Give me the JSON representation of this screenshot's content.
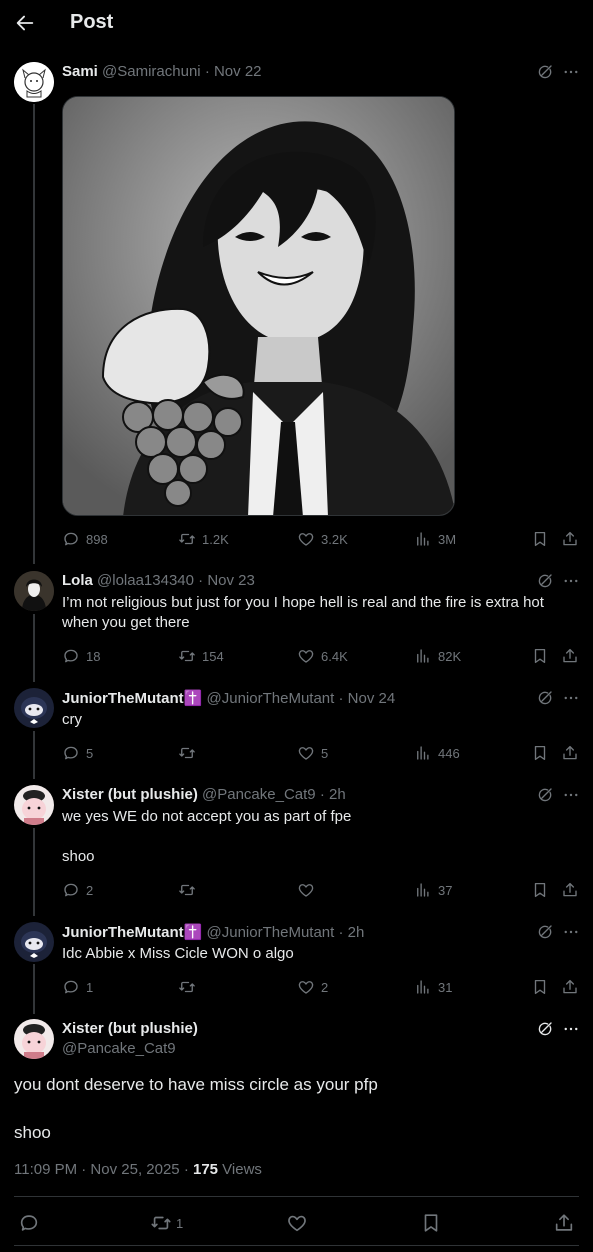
{
  "header": {
    "title": "Post"
  },
  "posts": [
    {
      "name": "Sami",
      "handle": "@Samirachuni",
      "date": "· Nov 22",
      "text": "",
      "replies": "898",
      "reposts": "1.2K",
      "likes": "3.2K",
      "views": "3M"
    },
    {
      "name": "Lola",
      "handle": "@lolaa134340",
      "date": "· Nov 23",
      "text": "I’m not religious but just for you I hope hell is real and the fire is extra hot when you get there",
      "replies": "18",
      "reposts": "154",
      "likes": "6.4K",
      "views": "82K"
    },
    {
      "name": "JuniorTheMutant✝️",
      "handle": "@JuniorTheMutant",
      "date": "· Nov 24",
      "text": "cry",
      "replies": "5",
      "reposts": "",
      "likes": "5",
      "views": "446"
    },
    {
      "name": "Xister (but plushie)",
      "handle": "@Pancake_Cat9",
      "date": "· 2h",
      "text": "we yes WE do not accept you as part of fpe",
      "text2": "shoo",
      "replies": "2",
      "reposts": "",
      "likes": "",
      "views": "37"
    },
    {
      "name": "JuniorTheMutant✝️",
      "handle": "@JuniorTheMutant",
      "date": "· 2h",
      "text": "Idc Abbie x Miss Cicle WON o algo",
      "replies": "1",
      "reposts": "",
      "likes": "2",
      "views": "31"
    }
  ],
  "main_post": {
    "name": "Xister (but plushie)",
    "handle": "@Pancake_Cat9",
    "line1": "you dont deserve to have miss circle as your pfp",
    "line2": "shoo",
    "time": "11:09 PM · Nov 25, 2025 · ",
    "views_count": "175",
    "views_label": " Views",
    "reposts": "1"
  },
  "icons": [
    "back-arrow-icon",
    "grok-icon",
    "more-icon",
    "reply-icon",
    "repost-icon",
    "like-icon",
    "views-icon",
    "bookmark-icon",
    "share-icon"
  ],
  "colors": {
    "background": "#000000",
    "text": "#e7e9ea",
    "muted": "#71767b",
    "border": "#2f3336"
  }
}
